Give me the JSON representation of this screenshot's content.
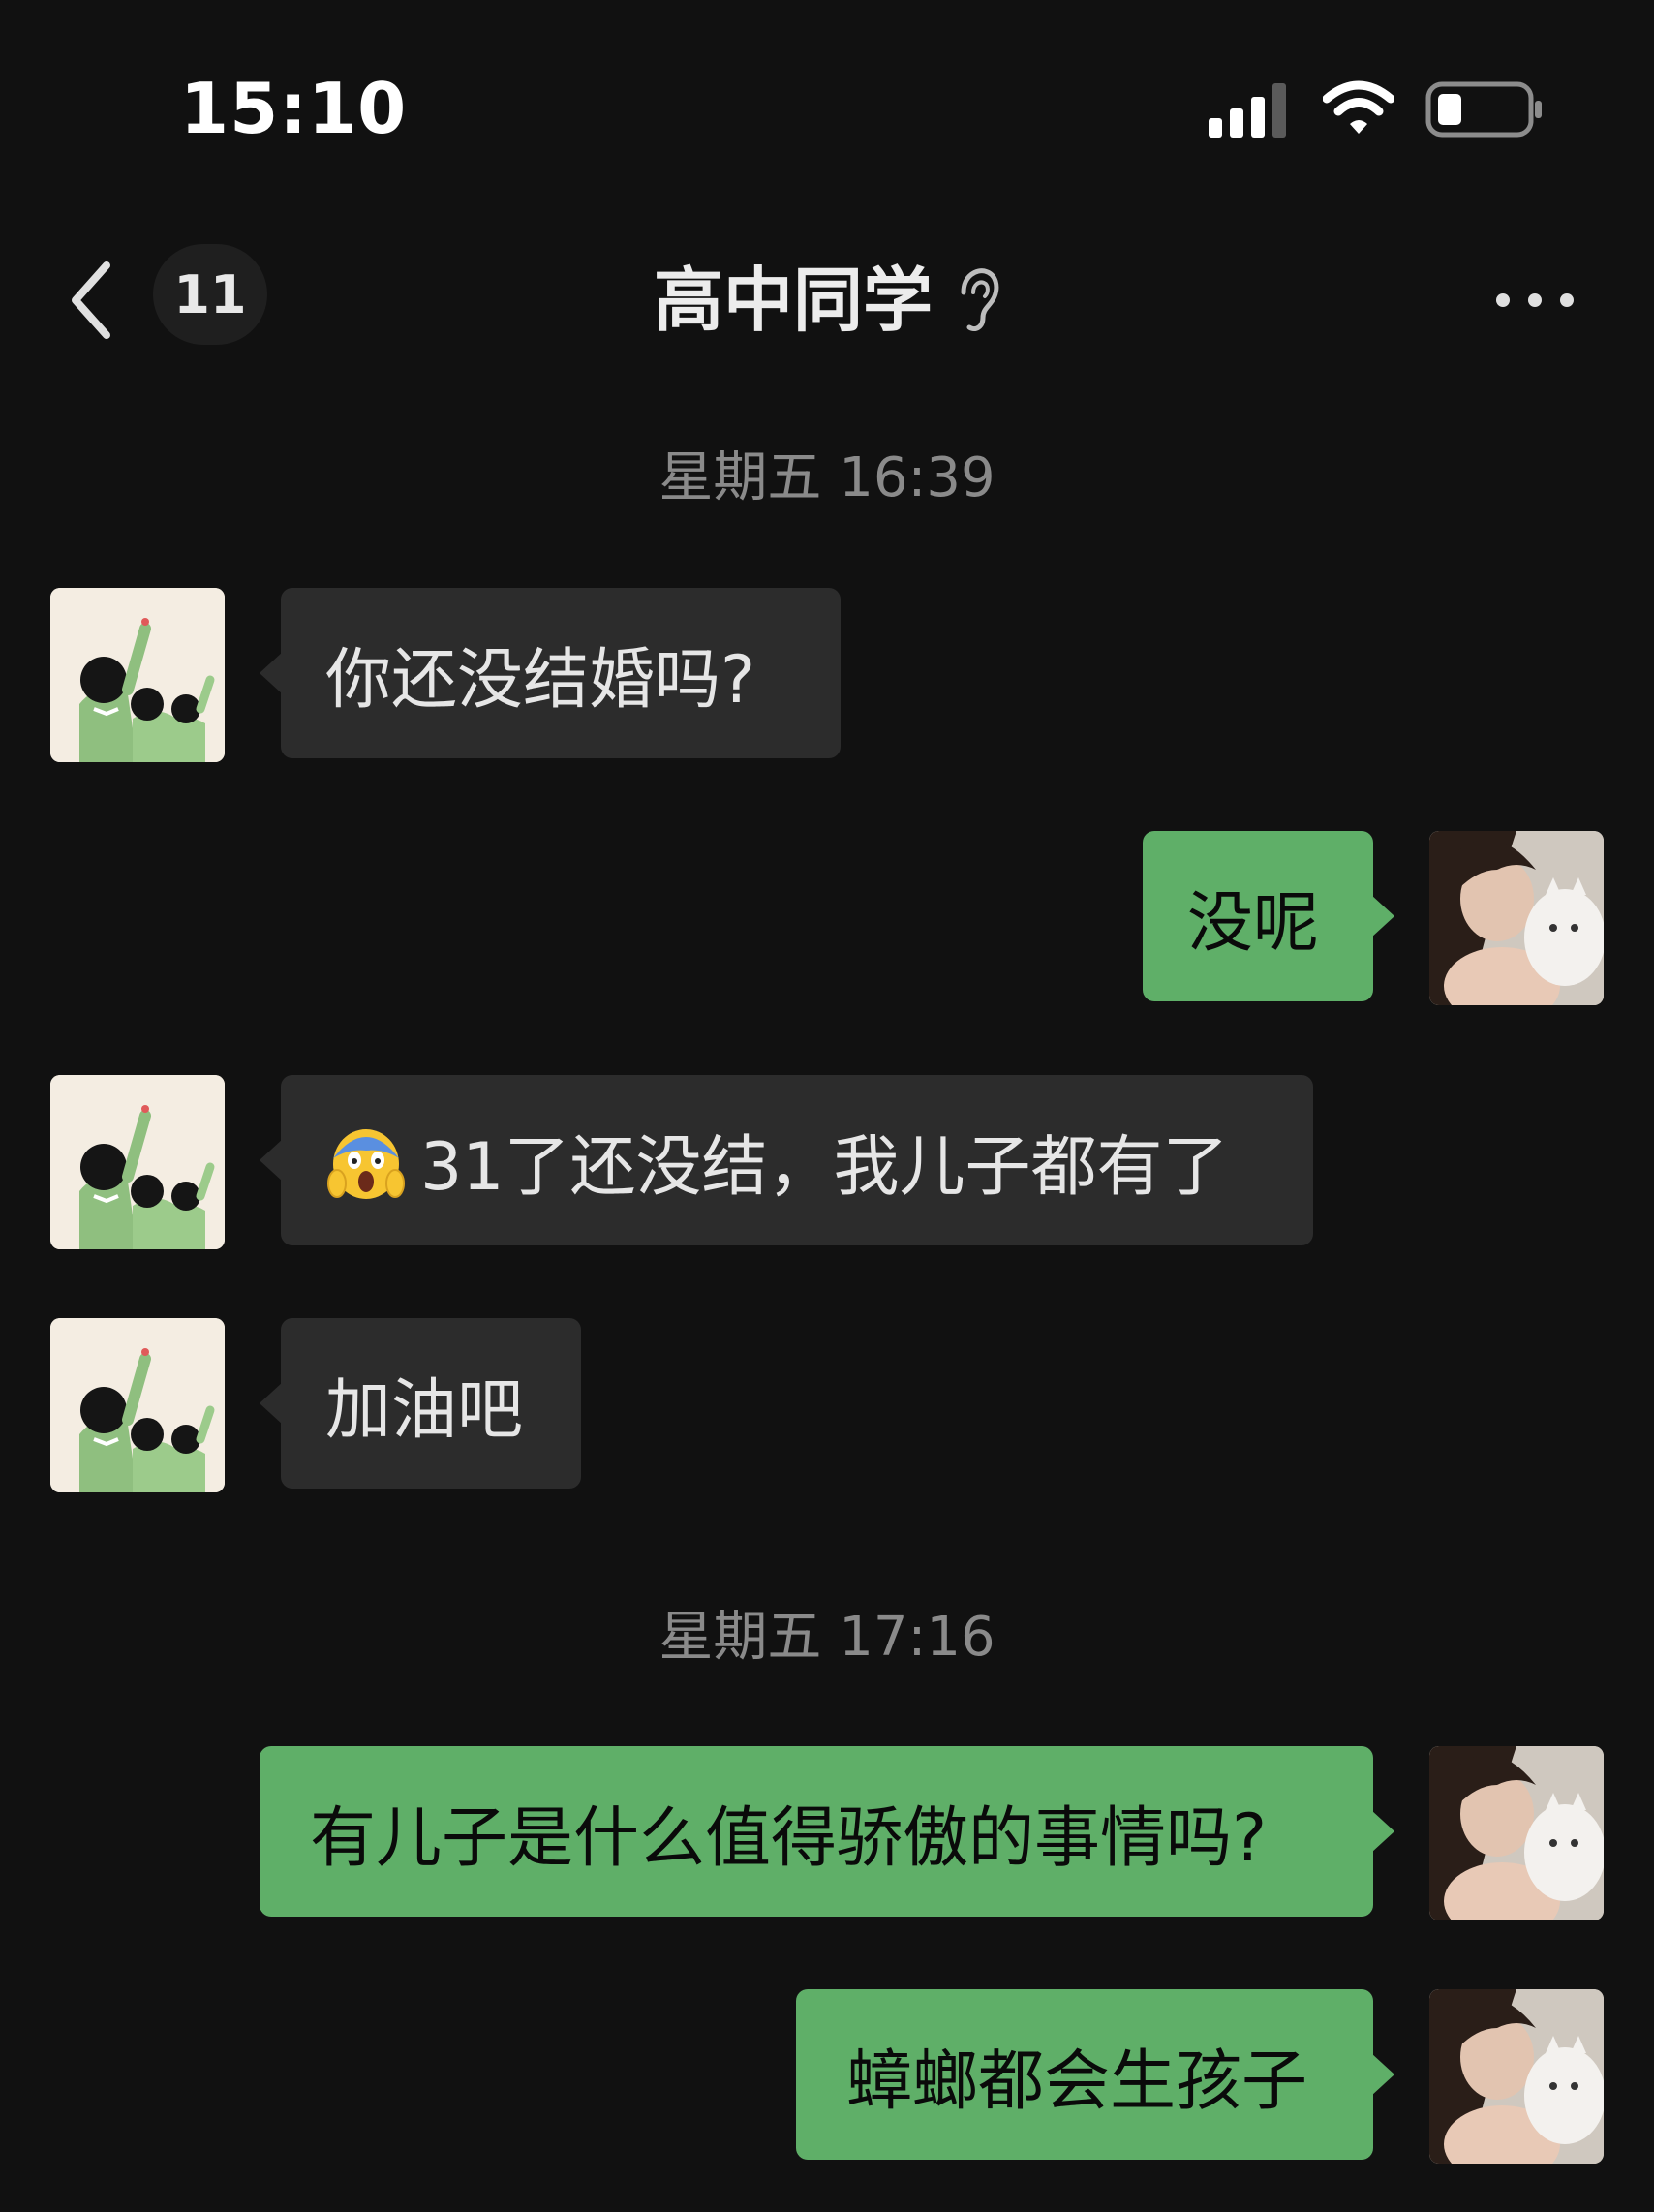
{
  "status_bar": {
    "time": "15:10",
    "icons": [
      "signal-icon",
      "wifi-icon",
      "battery-icon"
    ]
  },
  "nav": {
    "unread_count": "11",
    "title": "高中同学",
    "title_icon": "ear-icon",
    "more_icon": "more-icon",
    "back_icon": "back-icon"
  },
  "messages": {
    "timestamp_1": "星期五 16:39",
    "msg_1": "你还没结婚吗?",
    "msg_2": "没呢",
    "msg_3": "31了还没结，我儿子都有了",
    "msg_3_emoji": "scream-emoji",
    "msg_4": "加油吧",
    "timestamp_2": "星期五 17:16",
    "msg_5": "有儿子是什么值得骄傲的事情吗?",
    "msg_6": "蟑螂都会生孩子"
  },
  "colors": {
    "background": "#111111",
    "incoming_bubble": "#2c2c2c",
    "outgoing_bubble": "#5faf68",
    "timestamp_text": "#8a8a8a"
  }
}
